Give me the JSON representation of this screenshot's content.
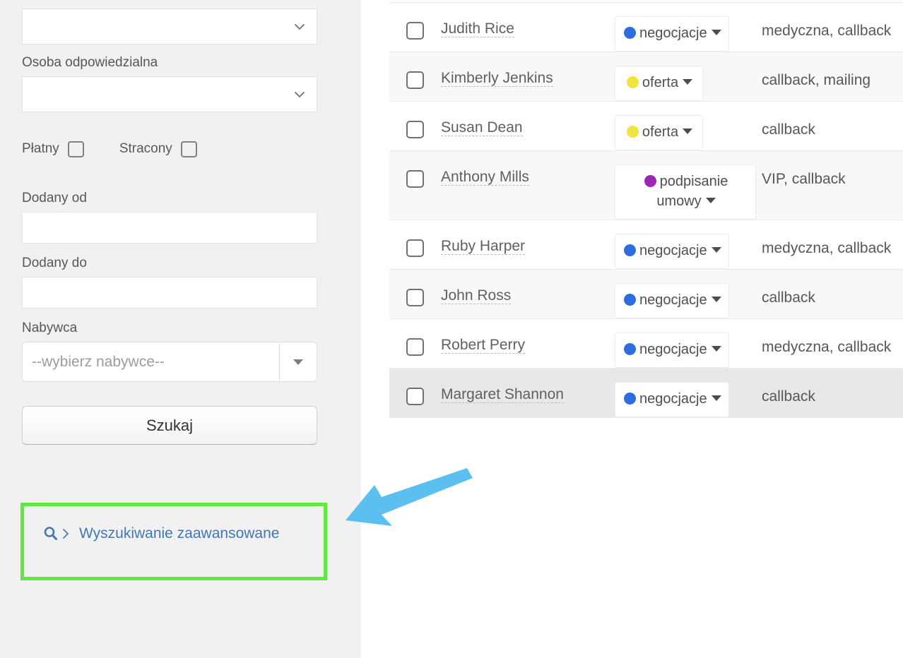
{
  "sidebar": {
    "top_select": {
      "value": "",
      "name": "top-select"
    },
    "osoba_label": "Osoba odpowiedzialna",
    "osoba_select": {
      "value": ""
    },
    "checkboxes": [
      {
        "label": "Płatny",
        "checked": false
      },
      {
        "label": "Stracony",
        "checked": false
      }
    ],
    "dodany_od_label": "Dodany od",
    "dodany_od_value": "",
    "dodany_do_label": "Dodany do",
    "dodany_do_value": "",
    "nabywca_label": "Nabywca",
    "nabywca_placeholder": "--wybierz nabywce--",
    "nabywca_value": "",
    "search_button_label": "Szukaj",
    "advanced_search_label": "Wyszukiwanie zaawansowane",
    "advanced_search_icons": [
      "search-icon",
      "chevron-right-icon"
    ],
    "highlight_color": "#5fe83f",
    "link_color": "#4277b5"
  },
  "annotation": {
    "arrow_color": "#5bc0f0",
    "arrow_points_to": "advanced-search-link"
  },
  "table": {
    "status_colors": {
      "negocjacje": "#2d6ce0",
      "oferta": "#ece63f",
      "podpisanie umowy": "#9c27b5"
    },
    "rows": [
      {
        "name": "Judith Rice",
        "status": "negocjacje",
        "status_wraps": true,
        "tags": "medyczna, callback",
        "checked": false,
        "background": "white"
      },
      {
        "name": "Kimberly Jenkins",
        "status": "oferta",
        "status_wraps": false,
        "tags": "callback, mailing",
        "checked": false,
        "background": "alt"
      },
      {
        "name": "Susan Dean",
        "status": "oferta",
        "status_wraps": false,
        "tags": "callback",
        "checked": false,
        "background": "white"
      },
      {
        "name": "Anthony Mills",
        "status": "podpisanie umowy",
        "status_wraps": true,
        "tags": "VIP, callback",
        "checked": false,
        "background": "alt"
      },
      {
        "name": "Ruby Harper",
        "status": "negocjacje",
        "status_wraps": true,
        "tags": "medyczna, callback",
        "checked": false,
        "background": "white"
      },
      {
        "name": "John Ross",
        "status": "negocjacje",
        "status_wraps": true,
        "tags": "callback",
        "checked": false,
        "background": "alt"
      },
      {
        "name": "Robert Perry",
        "status": "negocjacje",
        "status_wraps": true,
        "tags": "medyczna, callback",
        "checked": false,
        "background": "white"
      },
      {
        "name": "Margaret Shannon",
        "status": "negocjacje",
        "status_wraps": false,
        "tags": "callback",
        "checked": false,
        "background": "hover"
      }
    ]
  }
}
